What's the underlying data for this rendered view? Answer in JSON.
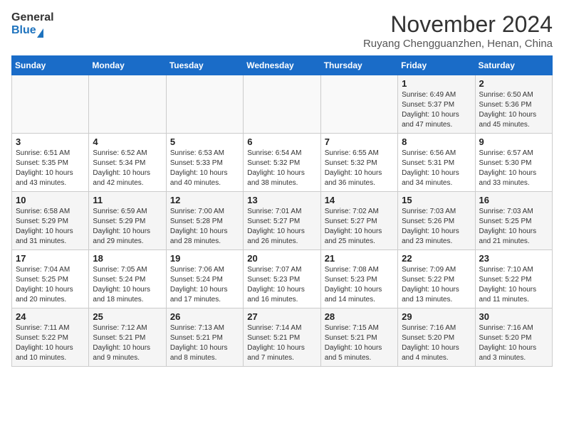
{
  "header": {
    "logo_general": "General",
    "logo_blue": "Blue",
    "month_title": "November 2024",
    "location": "Ruyang Chengguanzhen, Henan, China"
  },
  "days_of_week": [
    "Sunday",
    "Monday",
    "Tuesday",
    "Wednesday",
    "Thursday",
    "Friday",
    "Saturday"
  ],
  "weeks": [
    [
      {
        "day": "",
        "info": ""
      },
      {
        "day": "",
        "info": ""
      },
      {
        "day": "",
        "info": ""
      },
      {
        "day": "",
        "info": ""
      },
      {
        "day": "",
        "info": ""
      },
      {
        "day": "1",
        "info": "Sunrise: 6:49 AM\nSunset: 5:37 PM\nDaylight: 10 hours and 47 minutes."
      },
      {
        "day": "2",
        "info": "Sunrise: 6:50 AM\nSunset: 5:36 PM\nDaylight: 10 hours and 45 minutes."
      }
    ],
    [
      {
        "day": "3",
        "info": "Sunrise: 6:51 AM\nSunset: 5:35 PM\nDaylight: 10 hours and 43 minutes."
      },
      {
        "day": "4",
        "info": "Sunrise: 6:52 AM\nSunset: 5:34 PM\nDaylight: 10 hours and 42 minutes."
      },
      {
        "day": "5",
        "info": "Sunrise: 6:53 AM\nSunset: 5:33 PM\nDaylight: 10 hours and 40 minutes."
      },
      {
        "day": "6",
        "info": "Sunrise: 6:54 AM\nSunset: 5:32 PM\nDaylight: 10 hours and 38 minutes."
      },
      {
        "day": "7",
        "info": "Sunrise: 6:55 AM\nSunset: 5:32 PM\nDaylight: 10 hours and 36 minutes."
      },
      {
        "day": "8",
        "info": "Sunrise: 6:56 AM\nSunset: 5:31 PM\nDaylight: 10 hours and 34 minutes."
      },
      {
        "day": "9",
        "info": "Sunrise: 6:57 AM\nSunset: 5:30 PM\nDaylight: 10 hours and 33 minutes."
      }
    ],
    [
      {
        "day": "10",
        "info": "Sunrise: 6:58 AM\nSunset: 5:29 PM\nDaylight: 10 hours and 31 minutes."
      },
      {
        "day": "11",
        "info": "Sunrise: 6:59 AM\nSunset: 5:29 PM\nDaylight: 10 hours and 29 minutes."
      },
      {
        "day": "12",
        "info": "Sunrise: 7:00 AM\nSunset: 5:28 PM\nDaylight: 10 hours and 28 minutes."
      },
      {
        "day": "13",
        "info": "Sunrise: 7:01 AM\nSunset: 5:27 PM\nDaylight: 10 hours and 26 minutes."
      },
      {
        "day": "14",
        "info": "Sunrise: 7:02 AM\nSunset: 5:27 PM\nDaylight: 10 hours and 25 minutes."
      },
      {
        "day": "15",
        "info": "Sunrise: 7:03 AM\nSunset: 5:26 PM\nDaylight: 10 hours and 23 minutes."
      },
      {
        "day": "16",
        "info": "Sunrise: 7:03 AM\nSunset: 5:25 PM\nDaylight: 10 hours and 21 minutes."
      }
    ],
    [
      {
        "day": "17",
        "info": "Sunrise: 7:04 AM\nSunset: 5:25 PM\nDaylight: 10 hours and 20 minutes."
      },
      {
        "day": "18",
        "info": "Sunrise: 7:05 AM\nSunset: 5:24 PM\nDaylight: 10 hours and 18 minutes."
      },
      {
        "day": "19",
        "info": "Sunrise: 7:06 AM\nSunset: 5:24 PM\nDaylight: 10 hours and 17 minutes."
      },
      {
        "day": "20",
        "info": "Sunrise: 7:07 AM\nSunset: 5:23 PM\nDaylight: 10 hours and 16 minutes."
      },
      {
        "day": "21",
        "info": "Sunrise: 7:08 AM\nSunset: 5:23 PM\nDaylight: 10 hours and 14 minutes."
      },
      {
        "day": "22",
        "info": "Sunrise: 7:09 AM\nSunset: 5:22 PM\nDaylight: 10 hours and 13 minutes."
      },
      {
        "day": "23",
        "info": "Sunrise: 7:10 AM\nSunset: 5:22 PM\nDaylight: 10 hours and 11 minutes."
      }
    ],
    [
      {
        "day": "24",
        "info": "Sunrise: 7:11 AM\nSunset: 5:22 PM\nDaylight: 10 hours and 10 minutes."
      },
      {
        "day": "25",
        "info": "Sunrise: 7:12 AM\nSunset: 5:21 PM\nDaylight: 10 hours and 9 minutes."
      },
      {
        "day": "26",
        "info": "Sunrise: 7:13 AM\nSunset: 5:21 PM\nDaylight: 10 hours and 8 minutes."
      },
      {
        "day": "27",
        "info": "Sunrise: 7:14 AM\nSunset: 5:21 PM\nDaylight: 10 hours and 7 minutes."
      },
      {
        "day": "28",
        "info": "Sunrise: 7:15 AM\nSunset: 5:21 PM\nDaylight: 10 hours and 5 minutes."
      },
      {
        "day": "29",
        "info": "Sunrise: 7:16 AM\nSunset: 5:20 PM\nDaylight: 10 hours and 4 minutes."
      },
      {
        "day": "30",
        "info": "Sunrise: 7:16 AM\nSunset: 5:20 PM\nDaylight: 10 hours and 3 minutes."
      }
    ]
  ]
}
